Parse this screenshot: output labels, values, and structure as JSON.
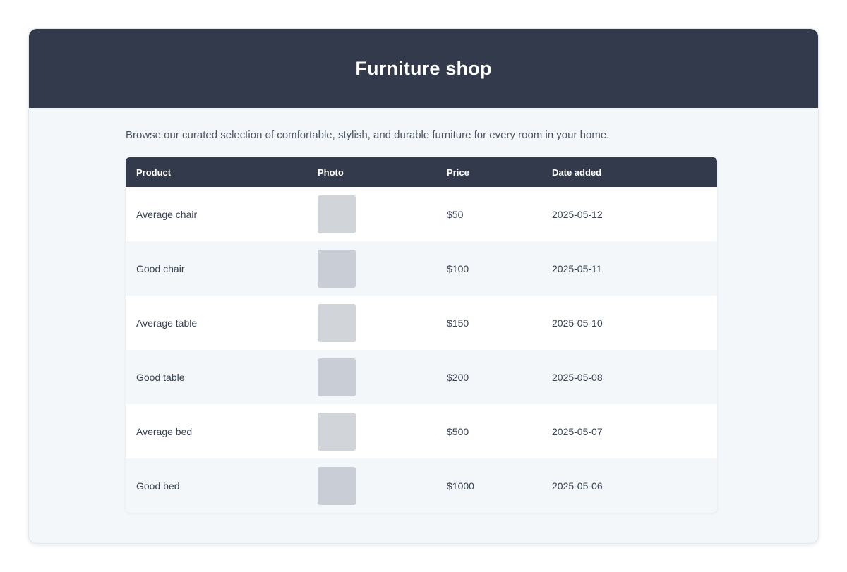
{
  "header": {
    "title": "Furniture shop"
  },
  "intro": "Browse our curated selection of comfortable, stylish, and durable furniture for every room in your home.",
  "table": {
    "columns": [
      "Product",
      "Photo",
      "Price",
      "Date added"
    ],
    "rows": [
      {
        "product": "Average chair",
        "price": "$50",
        "date": "2025-05-12"
      },
      {
        "product": "Good chair",
        "price": "$100",
        "date": "2025-05-11"
      },
      {
        "product": "Average table",
        "price": "$150",
        "date": "2025-05-10"
      },
      {
        "product": "Good table",
        "price": "$200",
        "date": "2025-05-08"
      },
      {
        "product": "Average bed",
        "price": "$500",
        "date": "2025-05-07"
      },
      {
        "product": "Good bed",
        "price": "$1000",
        "date": "2025-05-06"
      }
    ]
  }
}
